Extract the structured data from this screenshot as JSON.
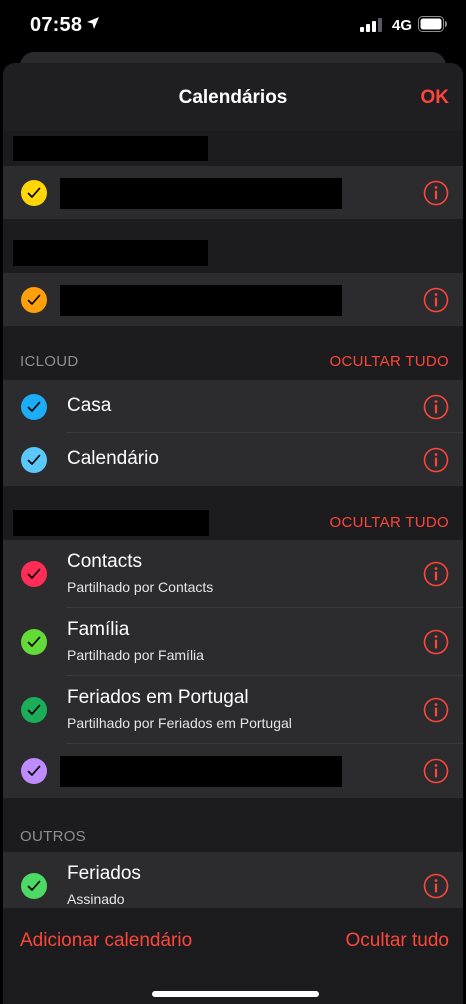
{
  "status_bar": {
    "time": "07:58",
    "network": "4G"
  },
  "nav": {
    "title": "Calendários",
    "ok_label": "OK"
  },
  "sections": [
    {
      "title": "",
      "hide_label": "",
      "rows": [
        {
          "title": "",
          "subtitle": "",
          "color": "#ffd60a"
        }
      ]
    },
    {
      "title": "",
      "hide_label": "",
      "rows": [
        {
          "title": "",
          "subtitle": "",
          "color": "#ff9f0a"
        }
      ]
    },
    {
      "title": "ICLOUD",
      "hide_label": "OCULTAR TUDO",
      "rows": [
        {
          "title": "Casa",
          "subtitle": "",
          "color": "#1badf8"
        },
        {
          "title": "Calendário",
          "subtitle": "",
          "color": "#5ac8fa"
        }
      ]
    },
    {
      "title": "",
      "hide_label": "OCULTAR TUDO",
      "rows": [
        {
          "title": "Contacts",
          "subtitle": "Partilhado por Contacts",
          "color": "#ff2d55"
        },
        {
          "title": "Família",
          "subtitle": "Partilhado por Família",
          "color": "#63da38"
        },
        {
          "title": "Feriados em Portugal",
          "subtitle": "Partilhado por Feriados em Portugal",
          "color": "#1bad59"
        },
        {
          "title": "",
          "subtitle": "",
          "color": "#bf8cff"
        }
      ]
    },
    {
      "title": "OUTROS",
      "hide_label": "",
      "rows": [
        {
          "title": "Feriados",
          "subtitle": "Assinado",
          "color": "#4cd964"
        }
      ]
    }
  ],
  "toolbar": {
    "add_label": "Adicionar calendário",
    "hide_all_label": "Ocultar tudo"
  },
  "colors": {
    "accent": "#ff453a",
    "background": "#1c1c1e",
    "row": "#2c2c2e"
  }
}
